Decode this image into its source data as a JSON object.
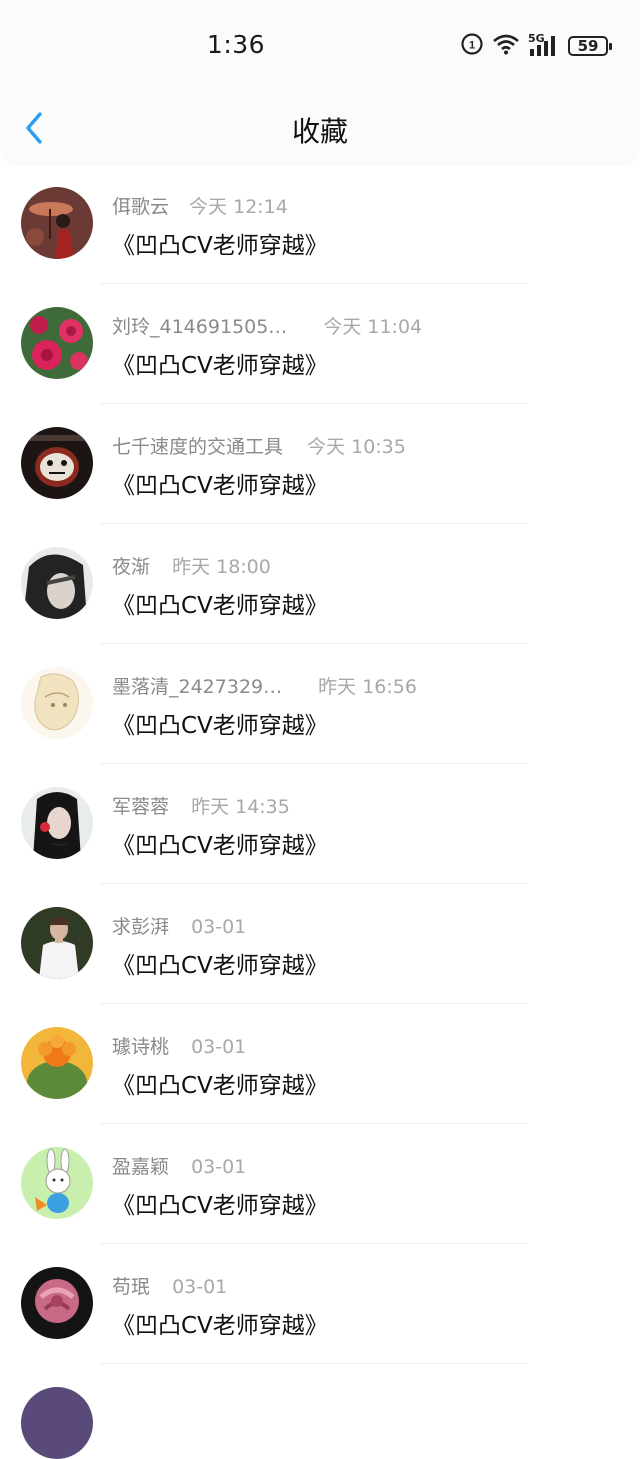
{
  "status_bar": {
    "time": "1:36",
    "network": "5G",
    "battery": "59"
  },
  "header": {
    "back_icon": "chevron-left-icon",
    "title": "收藏",
    "accent_color": "#2b9cf2"
  },
  "items": [
    {
      "name": "佴歌云",
      "time": "今天 12:14",
      "title": "《凹凸CV老师穿越》"
    },
    {
      "name": "刘玲_414691505…",
      "time": "今天 11:04",
      "title": "《凹凸CV老师穿越》"
    },
    {
      "name": "七千速度的交通工具",
      "time": "今天 10:35",
      "title": "《凹凸CV老师穿越》"
    },
    {
      "name": "夜渐",
      "time": "昨天 18:00",
      "title": "《凹凸CV老师穿越》"
    },
    {
      "name": "墨落清_2427329…",
      "time": "昨天 16:56",
      "title": "《凹凸CV老师穿越》"
    },
    {
      "name": "军蓉蓉",
      "time": "昨天 14:35",
      "title": "《凹凸CV老师穿越》"
    },
    {
      "name": "求彭湃",
      "time": "03-01",
      "title": "《凹凸CV老师穿越》"
    },
    {
      "name": "璩诗桃",
      "time": "03-01",
      "title": "《凹凸CV老师穿越》"
    },
    {
      "name": "盈嘉颖",
      "time": "03-01",
      "title": "《凹凸CV老师穿越》"
    },
    {
      "name": "苟珉",
      "time": "03-01",
      "title": "《凹凸CV老师穿越》"
    }
  ]
}
